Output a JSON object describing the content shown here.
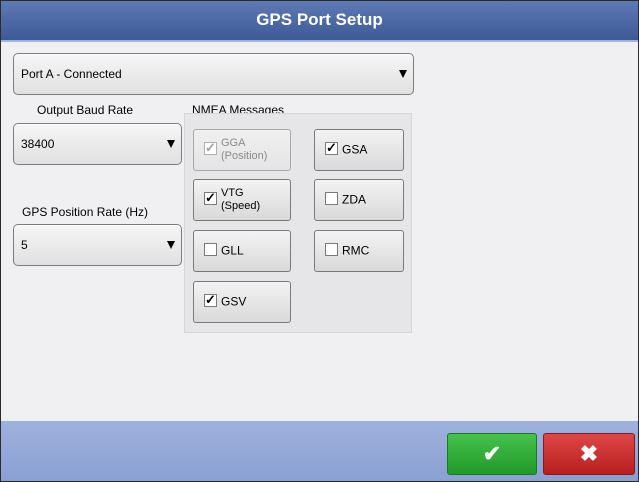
{
  "window": {
    "title": "GPS Port Setup"
  },
  "port_select": {
    "value": "Port A - Connected"
  },
  "baud": {
    "label": "Output Baud Rate",
    "value": "38400"
  },
  "position_rate": {
    "label": "GPS Position Rate (Hz)",
    "value": "5"
  },
  "nmea": {
    "label": "NMEA Messages",
    "items": [
      {
        "label": "GGA\n(Position)",
        "checked": true,
        "enabled": false
      },
      {
        "label": "GSA",
        "checked": true,
        "enabled": true
      },
      {
        "label": "VTG\n(Speed)",
        "checked": true,
        "enabled": true
      },
      {
        "label": "ZDA",
        "checked": false,
        "enabled": true
      },
      {
        "label": "GLL",
        "checked": false,
        "enabled": true
      },
      {
        "label": "RMC",
        "checked": false,
        "enabled": true
      },
      {
        "label": "GSV",
        "checked": true,
        "enabled": true
      }
    ]
  },
  "actions": {
    "ok_symbol": "✔",
    "cancel_symbol": "✖"
  },
  "colors": {
    "title_bar": "#4a67a3",
    "footer": "#94a8d8",
    "ok": "#2fae37",
    "cancel": "#c62828"
  }
}
